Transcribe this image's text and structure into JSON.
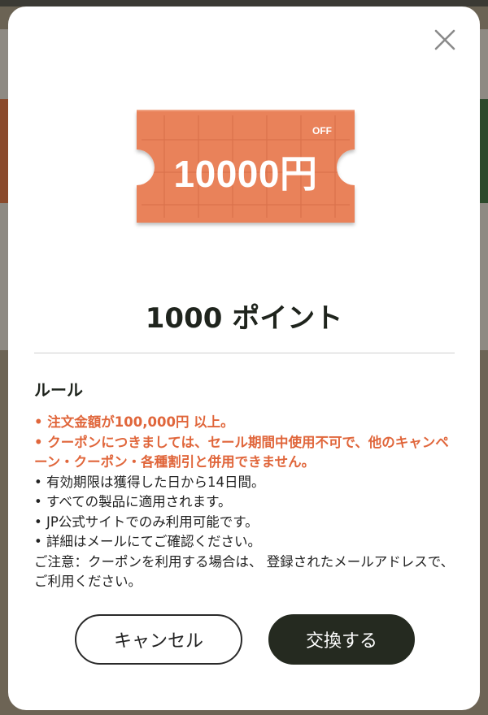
{
  "dialog": {
    "coupon": {
      "amount": "10000円",
      "badge": "OFF",
      "color": "#e9825a"
    },
    "points_label": "1000 ポイント",
    "rules": {
      "title": "ルール",
      "highlight_items": [
        "• 注文金額が100,000円 以上。",
        "• クーポンにつきましては、セール期間中使用不可で、他のキャンペーン・クーポン・各種割引と併用できません。"
      ],
      "items": [
        "• 有効期限は獲得した日から14日間。",
        "• すべての製品に適用されます。",
        "• JP公式サイトでのみ利用可能です。",
        "• 詳細はメールにてご確認ください。",
        "ご注意：クーポンを利用する場合は、 登録されたメールアドレスで、ご利用ください。"
      ]
    },
    "buttons": {
      "cancel": "キャンセル",
      "exchange": "交換する"
    },
    "icons": {
      "close": "close-icon"
    }
  }
}
